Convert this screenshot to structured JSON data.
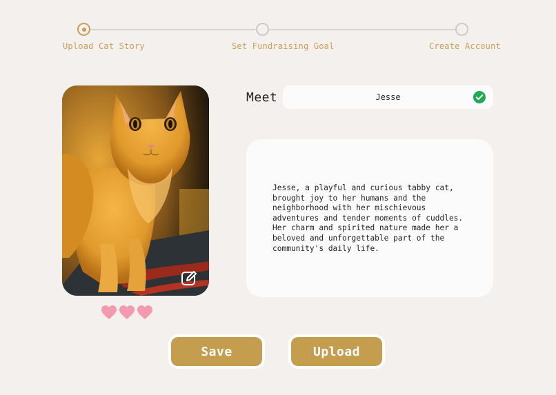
{
  "stepper": {
    "steps": [
      {
        "label": "Upload Cat Story",
        "active": true
      },
      {
        "label": "Set Fundraising Goal",
        "active": false
      },
      {
        "label": "Create Account",
        "active": false
      }
    ]
  },
  "photo": {
    "icon": "edit-icon"
  },
  "hearts": {
    "count": 3,
    "color": "#f49aae"
  },
  "name_row": {
    "label": "Meet",
    "value": "Jesse",
    "status_icon": "check-circle-icon",
    "status_color": "#1faa55"
  },
  "story": {
    "text": "Jesse, a playful and curious tabby cat,\nbrought joy to her humans and the\nneighborhood with her mischievous\nadventures and tender moments of cuddles.\nHer charm and spirited nature made her a\nbeloved and unforgettable part of the\ncommunity's daily life."
  },
  "actions": {
    "save_label": "Save",
    "upload_label": "Upload",
    "accent": "#c49d4f"
  }
}
